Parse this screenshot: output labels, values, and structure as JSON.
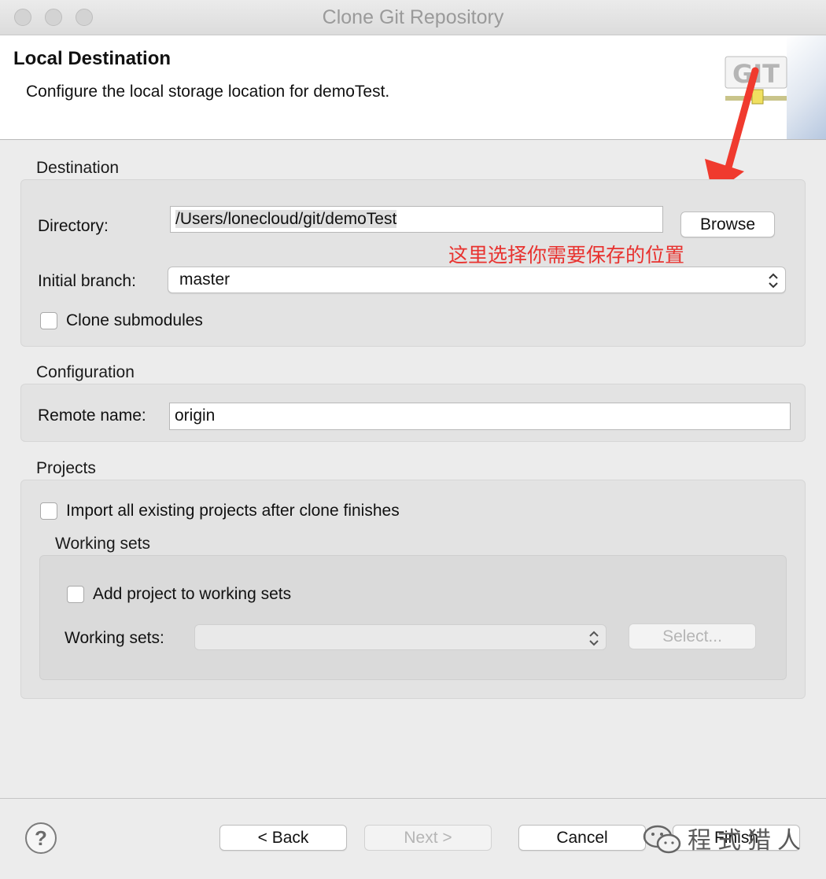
{
  "window": {
    "title": "Clone Git Repository"
  },
  "header": {
    "title": "Local Destination",
    "subtitle": "Configure the local storage location for demoTest.",
    "logo_text": "GIT"
  },
  "destination": {
    "section_label": "Destination",
    "directory_label": "Directory:",
    "directory_value": "/Users/lonecloud/git/demoTest",
    "browse_label": "Browse",
    "annotation": "这里选择你需要保存的位置",
    "branch_label": "Initial branch:",
    "branch_value": "master",
    "clone_submodules_label": "Clone submodules",
    "clone_submodules_checked": false
  },
  "configuration": {
    "section_label": "Configuration",
    "remote_name_label": "Remote name:",
    "remote_name_value": "origin"
  },
  "projects": {
    "section_label": "Projects",
    "import_label": "Import all existing projects after clone finishes",
    "import_checked": false,
    "working_sets_group_label": "Working sets",
    "add_to_working_sets_label": "Add project to working sets",
    "add_to_working_sets_checked": false,
    "working_sets_label": "Working sets:",
    "working_sets_value": "",
    "select_label": "Select..."
  },
  "footer": {
    "help_glyph": "?",
    "back_label": "< Back",
    "next_label": "Next >",
    "cancel_label": "Cancel",
    "finish_label": "Finish"
  },
  "watermark": {
    "text": "程式猎人"
  },
  "colors": {
    "annotation_red": "#e8322f",
    "window_bg": "#ececec"
  },
  "icons": [
    "help-icon",
    "git-logo-icon",
    "chevron-updown-icon",
    "red-arrow-icon",
    "wechat-icon"
  ]
}
